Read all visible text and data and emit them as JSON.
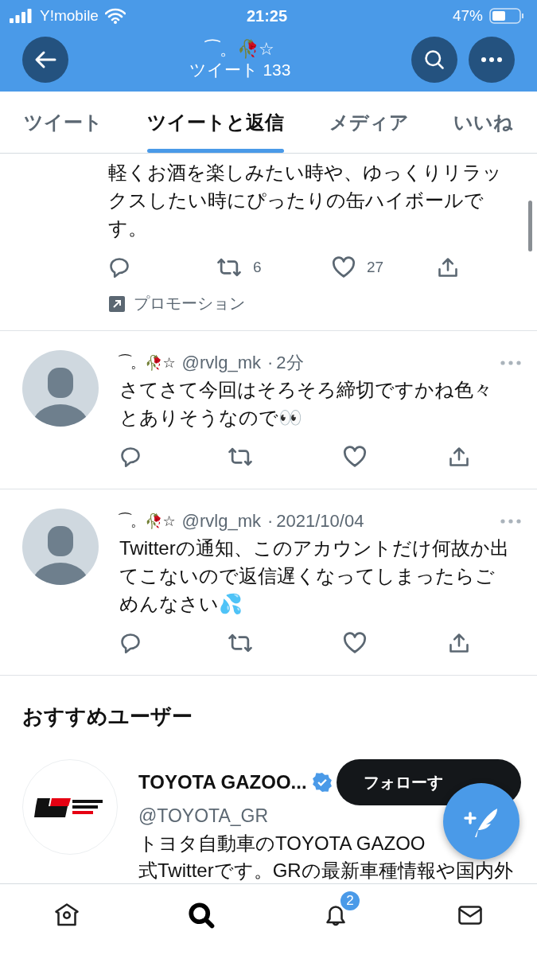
{
  "status_bar": {
    "carrier": "Y!mobile",
    "time": "21:25",
    "battery": "47%"
  },
  "header": {
    "name": "⁀。🥀☆",
    "subtitle": "ツイート 133"
  },
  "tabs": [
    {
      "label": "ツイート",
      "selected": false
    },
    {
      "label": "ツイートと返信",
      "selected": true
    },
    {
      "label": "メディア",
      "selected": false
    },
    {
      "label": "いいね",
      "selected": false
    }
  ],
  "tweets": [
    {
      "text": "軽くお酒を楽しみたい時や、ゆっくりリラックスしたい時にぴったりの缶ハイボールです。",
      "retweets": "6",
      "likes": "27",
      "promotion": "プロモーション"
    },
    {
      "name": "⁀。🥀☆",
      "handle": "@rvlg_mk",
      "separator": "·",
      "time": "2分",
      "text": "さてさて今回はそろそろ締切ですかね色々とありそうなので👀"
    },
    {
      "name": "⁀。🥀☆",
      "handle": "@rvlg_mk",
      "separator": "·",
      "time": "2021/10/04",
      "text": "Twitterの通知、このアカウントだけ何故か出てこないので返信遅くなってしまったらごめんなさい💦"
    }
  ],
  "suggestions": {
    "title": "おすすめユーザー",
    "users": [
      {
        "name": "TOYOTA GAZOO...",
        "verified": true,
        "handle": "@TOYOTA_GR",
        "follow": "フォローす",
        "bio": [
          "トヨタ自動車のTOYOTA GAZOO",
          "式Twitterです。GRの最新車種情報や国内外"
        ]
      }
    ]
  },
  "bottom_nav": [
    {
      "kind": "home",
      "selected": false
    },
    {
      "kind": "search",
      "selected": true
    },
    {
      "kind": "notifications",
      "selected": false,
      "badge": "2"
    },
    {
      "kind": "messages",
      "selected": false
    }
  ]
}
